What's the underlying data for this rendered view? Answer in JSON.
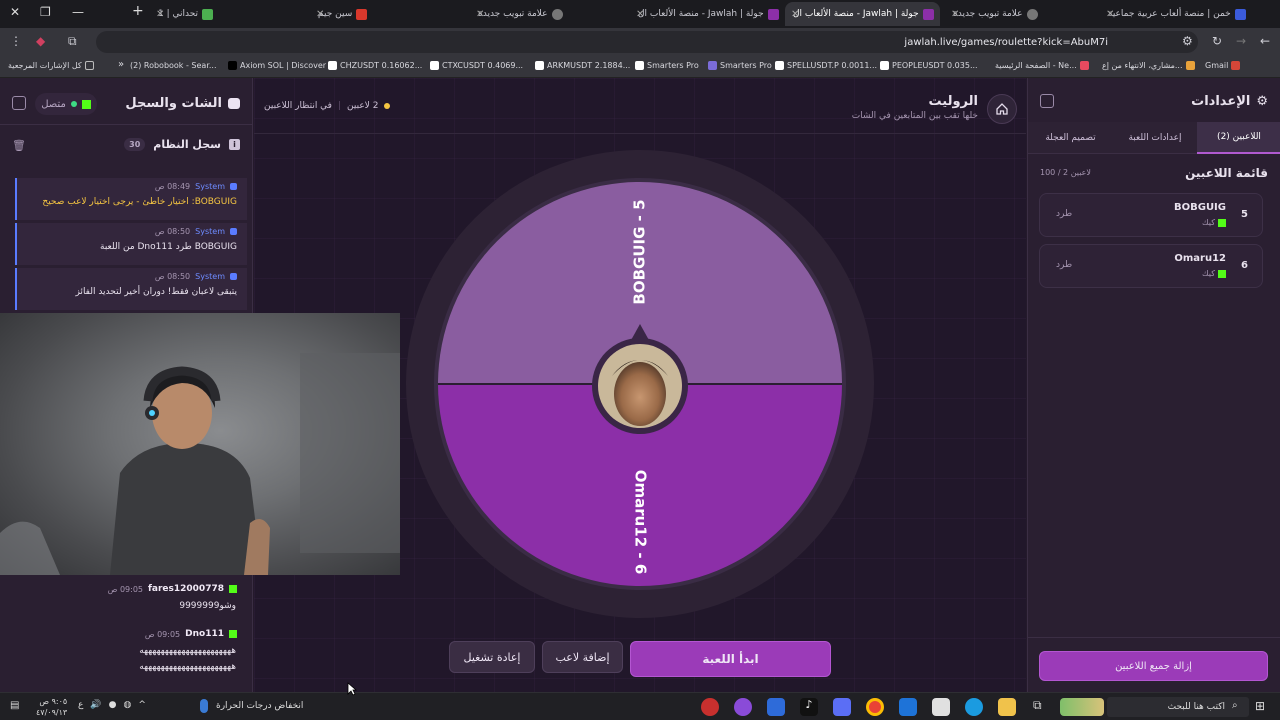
{
  "browser": {
    "tabs": [
      {
        "title": "خمن | منصة ألعاب عربية جماعية",
        "active": false
      },
      {
        "title": "علامة تبويب جديدة",
        "active": false
      },
      {
        "title": "جولة | Jawlah - منصة الألعاب ال",
        "active": true
      },
      {
        "title": "جولة | Jawlah - منصة الألعاب ال",
        "active": false
      },
      {
        "title": "علامة تبويب جديدة",
        "active": false
      },
      {
        "title": "سين جيم",
        "active": false
      },
      {
        "title": "تحداني | 1",
        "active": false
      }
    ],
    "url": "jawlah.live/games/roulette?kick=AbuM7i",
    "bookmarks": [
      "Gmail",
      "مشاري، الانتهاء من إع...",
      "الصفحة الرئيسية - Ne...",
      "PEOPLEUSDT 0.035...",
      "SPELLUSDT.P 0.0011...",
      "Smarters Pro",
      "Smarters Pro",
      "ARKMUSDT 2.1884...",
      "CTXCUSDT 0.4069...",
      "CHZUSDT 0.16062...",
      "Axiom SOL | Discover",
      "(2) Robobook - Sear...",
      "كل الإشارات المرجعية"
    ]
  },
  "settings": {
    "title": "الإعدادات",
    "tabs": [
      "اللاعبين (2)",
      "إعدادات اللعبة",
      "تصميم العجلة"
    ],
    "player_list_title": "قائمة اللاعبين",
    "player_count": "100 / 2 لاعبين",
    "players": [
      {
        "number": "5",
        "name": "BOBGUIG",
        "platform": "كيك",
        "kick_label": "طرد"
      },
      {
        "number": "6",
        "name": "Omaru12",
        "platform": "كيك",
        "kick_label": "طرد"
      }
    ],
    "remove_all": "إزالة جميع اللاعبين"
  },
  "game": {
    "title": "الروليت",
    "subtitle": "خلها تقب بين المتابعين في الشات",
    "player_status": "2 لاعبين",
    "waiting": "في انتظار اللاعبين",
    "segments": [
      {
        "label": "BOBGUIG - 5",
        "color": "#8a5da0"
      },
      {
        "label": "Omaru12 - 6",
        "color": "#8c2fa8"
      }
    ],
    "start_button": "ابدأ اللعبة",
    "add_player_button": "إضافة لاعب",
    "restart_button": "إعادة تشغيل"
  },
  "chat": {
    "title": "الشات والسجل",
    "status": "متصل",
    "log_title": "سجل النظام",
    "log_count": "30",
    "system_messages": [
      {
        "sender": "System",
        "time": "08:49 ص",
        "text": "BOBGUIG: اختيار خاطئ - يرجى اختيار لاعب صحيح",
        "warn": true
      },
      {
        "sender": "System",
        "time": "08:50 ص",
        "text": "BOBGUIG طرد Dno111 من اللعبة",
        "warn": false
      },
      {
        "sender": "System",
        "time": "08:50 ص",
        "text": "يتبقى لاعبان فقط! دوران أخير لتحديد الفائز",
        "warn": false
      }
    ],
    "user_messages": [
      {
        "user": "fares12000778",
        "time": "09:05 ص",
        "text": "وشو9999999"
      },
      {
        "user": "Dno111",
        "time": "09:05 ص",
        "text": "ههههههههههههههههههههههه"
      },
      {
        "user": "",
        "time": "",
        "text": "ههههههههههههههههههههههه"
      }
    ]
  },
  "taskbar": {
    "search": "اكتب هنا للبحث",
    "weather": "انخفاض درجات الحرارة",
    "time": "٩:٠٥ ص",
    "date": "٤٧/٠٩/١٣"
  }
}
